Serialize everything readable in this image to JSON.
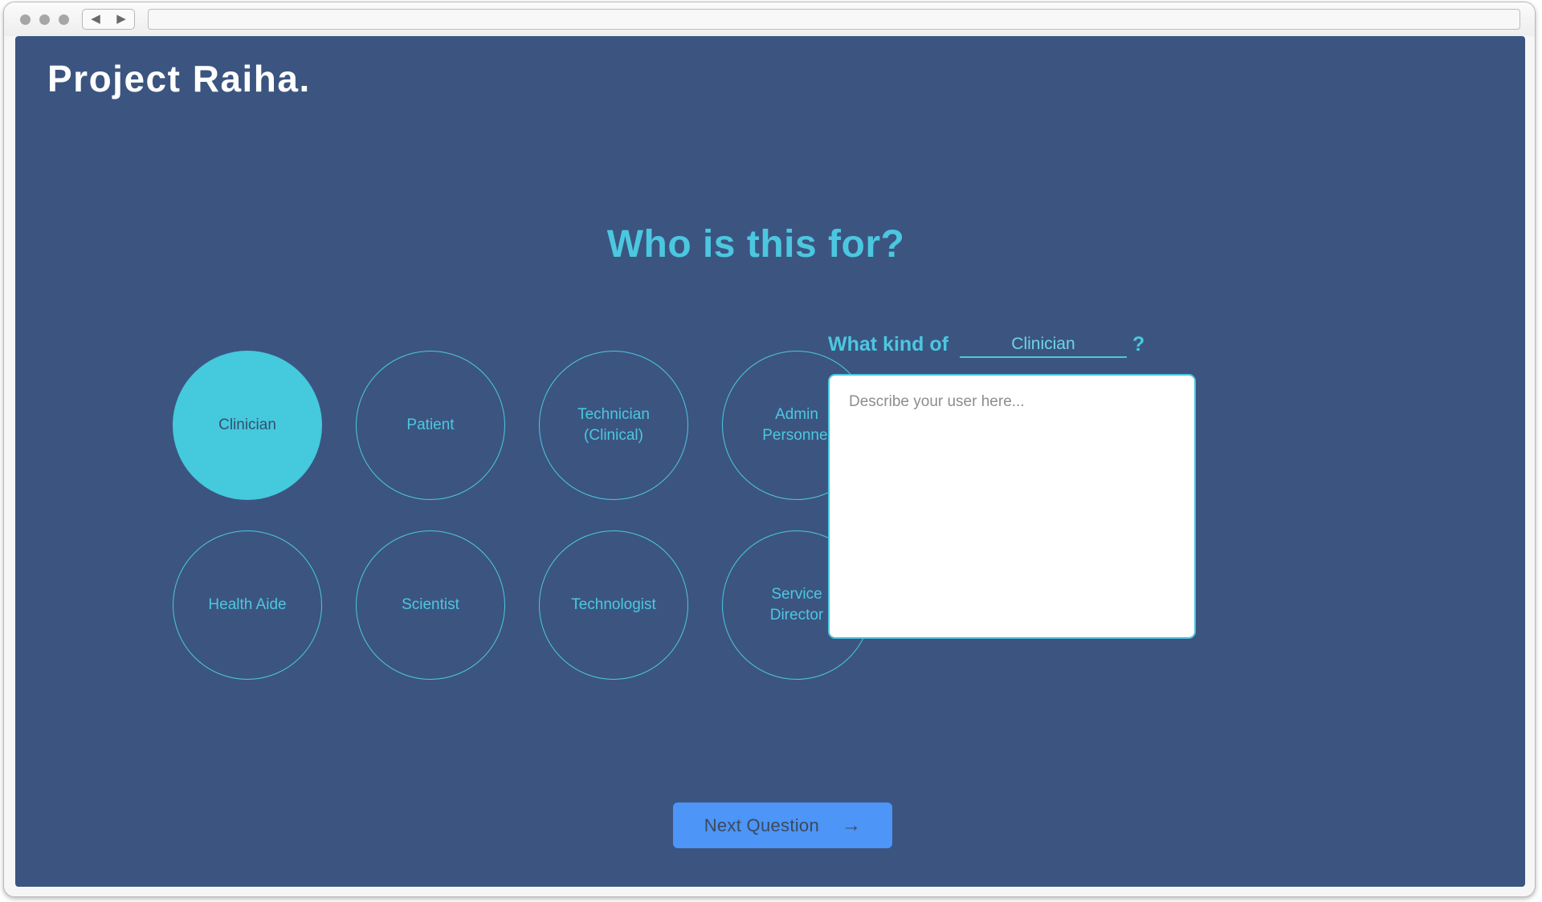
{
  "browser": {
    "traffic_lights": [
      "close",
      "minimize",
      "maximize"
    ],
    "back_arrow": "◀",
    "forward_arrow": "▶",
    "url_value": ""
  },
  "page": {
    "logo": "Project Raiha.",
    "headline": "Who is this for?",
    "background_color": "#3b5580",
    "accent_color": "#4cc7e0",
    "selected_fill_color": "#45c9dd",
    "button_color": "#4d95f7"
  },
  "options": [
    {
      "id": "clinician",
      "line1": "Clinician",
      "line2": "",
      "selected": true
    },
    {
      "id": "patient",
      "line1": "Patient",
      "line2": "",
      "selected": false
    },
    {
      "id": "technician-clinical",
      "line1": "Technician",
      "line2": "(Clinical)",
      "selected": false
    },
    {
      "id": "admin-personnel",
      "line1": "Admin",
      "line2": "Personnel",
      "selected": false
    },
    {
      "id": "health-aide",
      "line1": "Health Aide",
      "line2": "",
      "selected": false
    },
    {
      "id": "scientist",
      "line1": "Scientist",
      "line2": "",
      "selected": false
    },
    {
      "id": "technologist",
      "line1": "Technologist",
      "line2": "",
      "selected": false
    },
    {
      "id": "service-director",
      "line1": "Service",
      "line2": "Director",
      "selected": false
    }
  ],
  "detail": {
    "question_lead": "What kind of",
    "question_blank_value": "Clinician",
    "question_mark": "?",
    "describe_placeholder": "Describe your user here...",
    "describe_value": ""
  },
  "footer": {
    "next_label": "Next Question",
    "next_arrow": "→"
  }
}
